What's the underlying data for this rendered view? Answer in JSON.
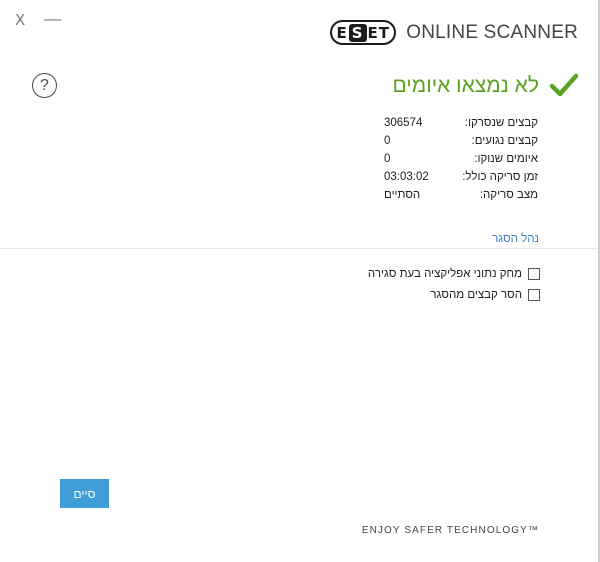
{
  "window": {
    "close_glyph": "X",
    "minimize_glyph": "—"
  },
  "brand": {
    "badge": "ESET",
    "product": "ONLINE SCANNER",
    "slogan": "ENJOY SAFER TECHNOLOGY™"
  },
  "help": {
    "glyph": "?"
  },
  "result": {
    "title": "לא נמצאו איומים",
    "icon": "check-icon",
    "color": "#5aa221"
  },
  "stats": [
    {
      "label": "קבצים שנסרקו:",
      "value": "306574"
    },
    {
      "label": "קבצים נגועים:",
      "value": "0"
    },
    {
      "label": "איומים שנוקו:",
      "value": "0"
    },
    {
      "label": "זמן סריקה כולל:",
      "value": "03:03:02"
    },
    {
      "label": "מצב סריקה:",
      "value": "הסתיים"
    }
  ],
  "quarantine_link": "נהל הסגר",
  "options": [
    {
      "label": "מחק נתוני אפליקציה בעת סגירה",
      "checked": false
    },
    {
      "label": "הסר קבצים מהסגר",
      "checked": false
    }
  ],
  "finish_button": "סיים",
  "accent_color": "#3f9ed8"
}
